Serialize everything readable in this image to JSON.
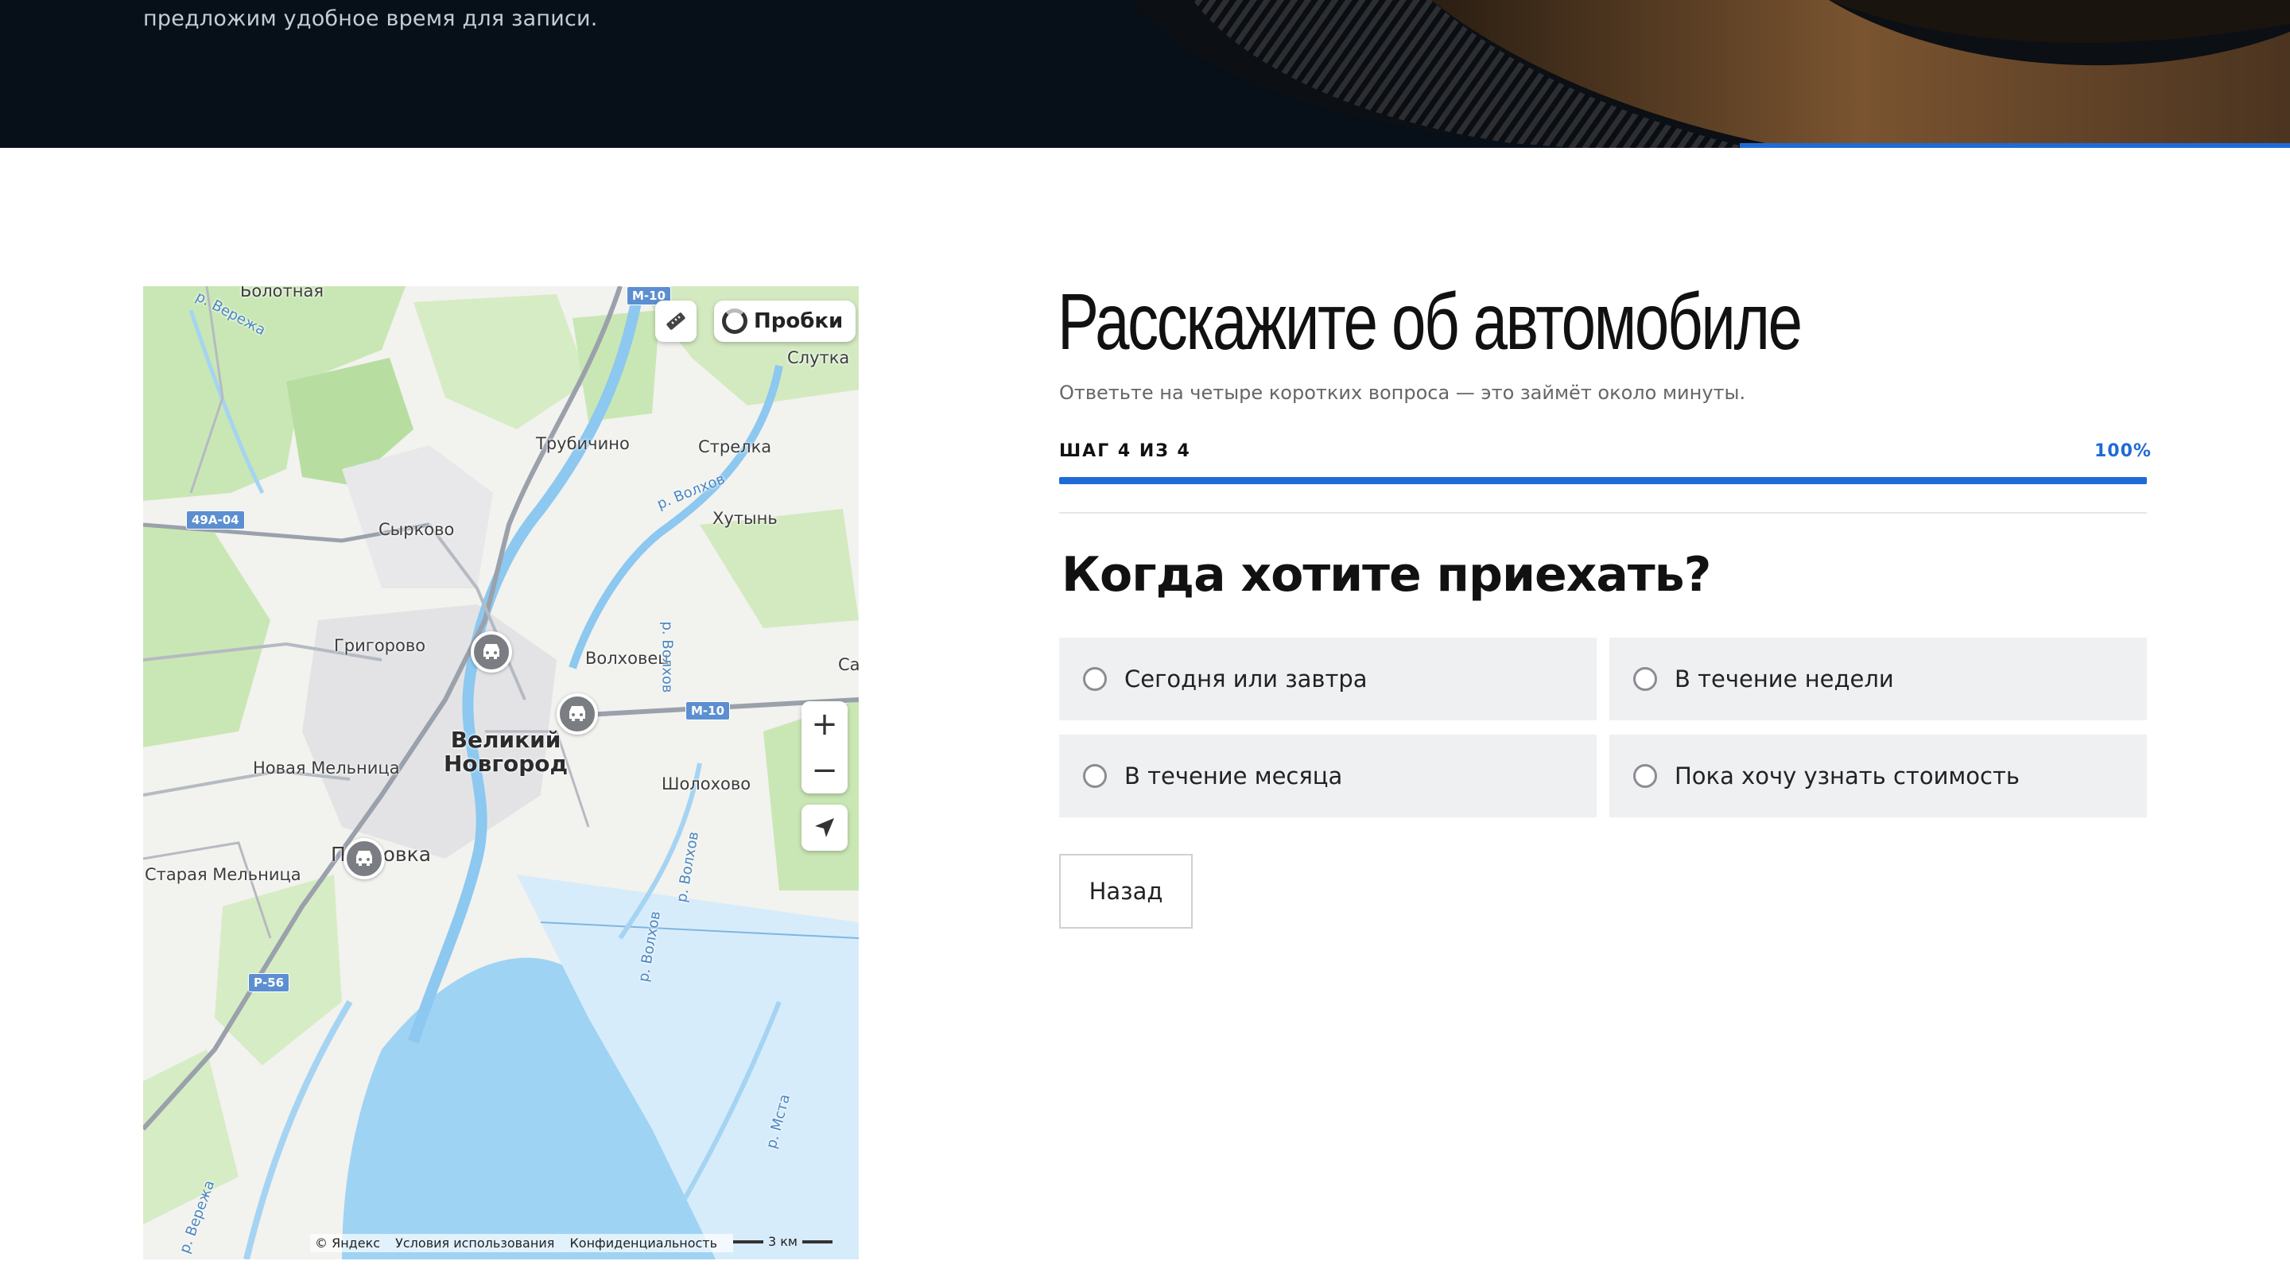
{
  "hero": {
    "text": "предложим удобное время для записи.",
    "progress_fraction": 0.24
  },
  "map": {
    "traffic_label": "Пробки",
    "labels": {
      "bolotnaya": "Болотная",
      "sluтка": "Слутка",
      "trubichino": "Трубичино",
      "strelka": "Стрелка",
      "khutyn": "Хутынь",
      "syrkovo": "Сырково",
      "grigorovo": "Григорово",
      "volkhovets": "Волховец",
      "sa": "Са",
      "city_line1": "Великий",
      "city_line2": "Новгород",
      "novaya_melnitsa": "Новая Мельница",
      "sholokhovo": "Шолохово",
      "pankovka": "Панковка",
      "staraya_melnitsa": "Старая Мельница",
      "r_verezha_top": "р. Вережа",
      "r_verezha_bottom": "р. Вережа",
      "r_volkhov_1": "р. Волхов",
      "r_volkhov_2": "р. Волхов",
      "r_volkhov_3": "р. Волхов",
      "r_volkhov_4": "р. Волхов",
      "r_msta": "р. Мста"
    },
    "roads": {
      "a": "49А-04",
      "b": "М-10",
      "c": "М-10",
      "d": "Р-56"
    },
    "zoom_in": "+",
    "zoom_out": "−",
    "footer": {
      "copyright": "© Яндекс",
      "terms": "Условия использования",
      "privacy": "Конфиденциальность"
    },
    "scale": "3 км"
  },
  "form": {
    "title": "Расскажите об автомобиле",
    "subtitle": "Ответьте на четыре коротких вопроса — это займёт около минуты.",
    "step_label": "ШАГ 4 ИЗ 4",
    "step_percent": "100%",
    "progress_fraction": 1.0,
    "question": "Когда хотите приехать?",
    "options": [
      "Сегодня или завтра",
      "В течение недели",
      "В течение месяца",
      "Пока хочу узнать стоимость"
    ],
    "back_label": "Назад"
  },
  "colors": {
    "accent": "#1f6bd6",
    "hero_bg": "#071019",
    "option_bg": "#eff0f2"
  }
}
